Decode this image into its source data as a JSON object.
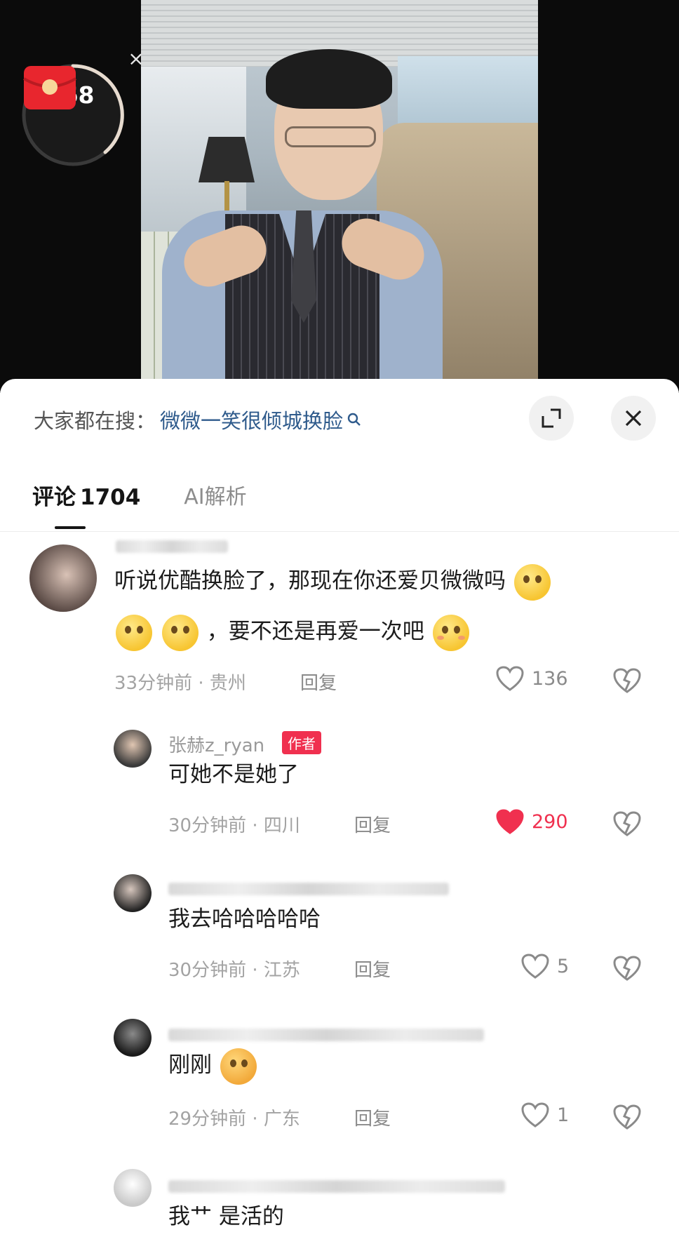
{
  "red_packet": {
    "count": "568",
    "close_label": "×"
  },
  "search": {
    "prefix": "大家都在搜：",
    "term": "微微一笑很倾城换脸"
  },
  "tabs": {
    "comments_label": "评论",
    "comments_count": "1704",
    "ai_label": "AI解析"
  },
  "icons": {
    "search": "search-icon",
    "expand": "expand-icon",
    "close": "close-icon",
    "like": "heart-icon",
    "dislike": "broken-heart-icon",
    "red_packet": "red-envelope-icon"
  },
  "colors": {
    "accent": "#f0304f",
    "search_term": "#2f5b8c",
    "text": "#1c1c1c",
    "muted": "#a3a3a3"
  },
  "comments": [
    {
      "text_line1": "听说优酷换脸了，那现在你还爱贝微微吗",
      "text_line2": "，要不还是再爱一次吧",
      "time": "33分钟前 · 贵州",
      "reply_label": "回复",
      "likes": "136",
      "liked": false
    },
    {
      "username": "张赫z_ryan",
      "badge": "作者",
      "text": "可她不是她了",
      "time": "30分钟前 · 四川",
      "reply_label": "回复",
      "likes": "290",
      "liked": true
    },
    {
      "text": "我去哈哈哈哈哈",
      "time": "30分钟前 · 江苏",
      "reply_label": "回复",
      "likes": "5",
      "liked": false
    },
    {
      "text": "刚刚",
      "time": "29分钟前 · 广东",
      "reply_label": "回复",
      "likes": "1",
      "liked": false
    },
    {
      "text": "我艹 是活的"
    }
  ]
}
